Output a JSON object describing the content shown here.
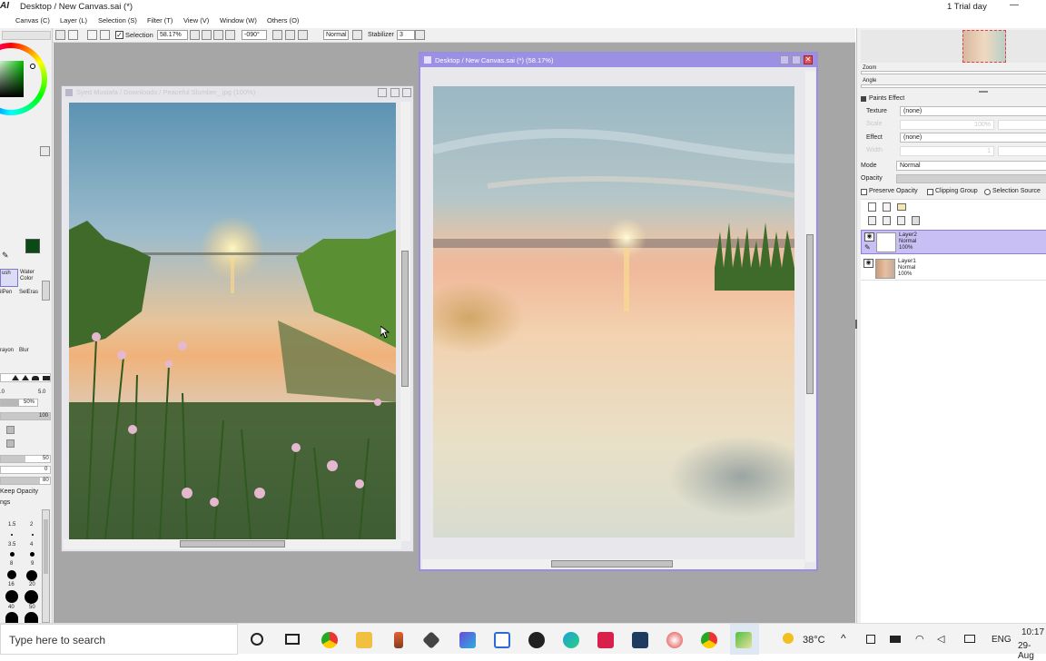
{
  "app": {
    "title_prefix": "AI",
    "title": "Desktop / New Canvas.sai (*)",
    "trial": "1 Trial day",
    "minimize": "—"
  },
  "menu": [
    "Canvas (C)",
    "Layer (L)",
    "Selection (S)",
    "Filter (T)",
    "View (V)",
    "Window (W)",
    "Others (O)"
  ],
  "toolbar": {
    "selection_label": "Selection",
    "zoom": "58.17%",
    "angle": "-090°",
    "blend": "Normal",
    "stabilizer_label": "Stabilizer",
    "stabilizer_value": "3"
  },
  "left_panel": {
    "tools_row1": [
      "ush",
      "Water Color"
    ],
    "tools_row2": [
      "ilPen",
      "SelEras"
    ],
    "tools_row3": [
      "rayon",
      "Blur"
    ],
    "min_size": ".0",
    "max_size": "5.0",
    "density": "50%",
    "values": [
      "100",
      "50",
      "0",
      "80"
    ],
    "keep_opacity": "Keep Opacity",
    "ngs": "ngs",
    "brush_sizes": [
      "1.5",
      "2",
      "3.5",
      "4",
      "8",
      "9",
      "16",
      "20",
      "40",
      "50"
    ],
    "primary_color": "#0b4a14"
  },
  "reference_window": {
    "title": "Syed Mustafa / Downloads / Peaceful Slumber_.jpg (100%)"
  },
  "canvas_window": {
    "title": "Desktop / New Canvas.sai (*) (58.17%)"
  },
  "right_panel": {
    "zoom_label": "Zoom",
    "angle_label": "Angle",
    "paints_effect": "Paints Effect",
    "texture_label": "Texture",
    "texture_value": "(none)",
    "scale_label": "Scale",
    "scale_value": "100%",
    "effect_label": "Effect",
    "effect_value": "(none)",
    "width_label": "Width",
    "width_value": "1",
    "mode_label": "Mode",
    "mode_value": "Normal",
    "opacity_label": "Opacity",
    "preserve_opacity": "Preserve Opacity",
    "clipping_group": "Clipping Group",
    "selection_source": "Selection Source",
    "layers": [
      {
        "name": "Layer2",
        "mode": "Normal",
        "opacity": "100%",
        "selected": true
      },
      {
        "name": "Layer1",
        "mode": "Normal",
        "opacity": "100%",
        "selected": false
      }
    ]
  },
  "taskbar": {
    "search_placeholder": "Type here to search",
    "temperature": "38°C",
    "language": "ENG",
    "time": "10:17",
    "date": "29-Aug"
  }
}
